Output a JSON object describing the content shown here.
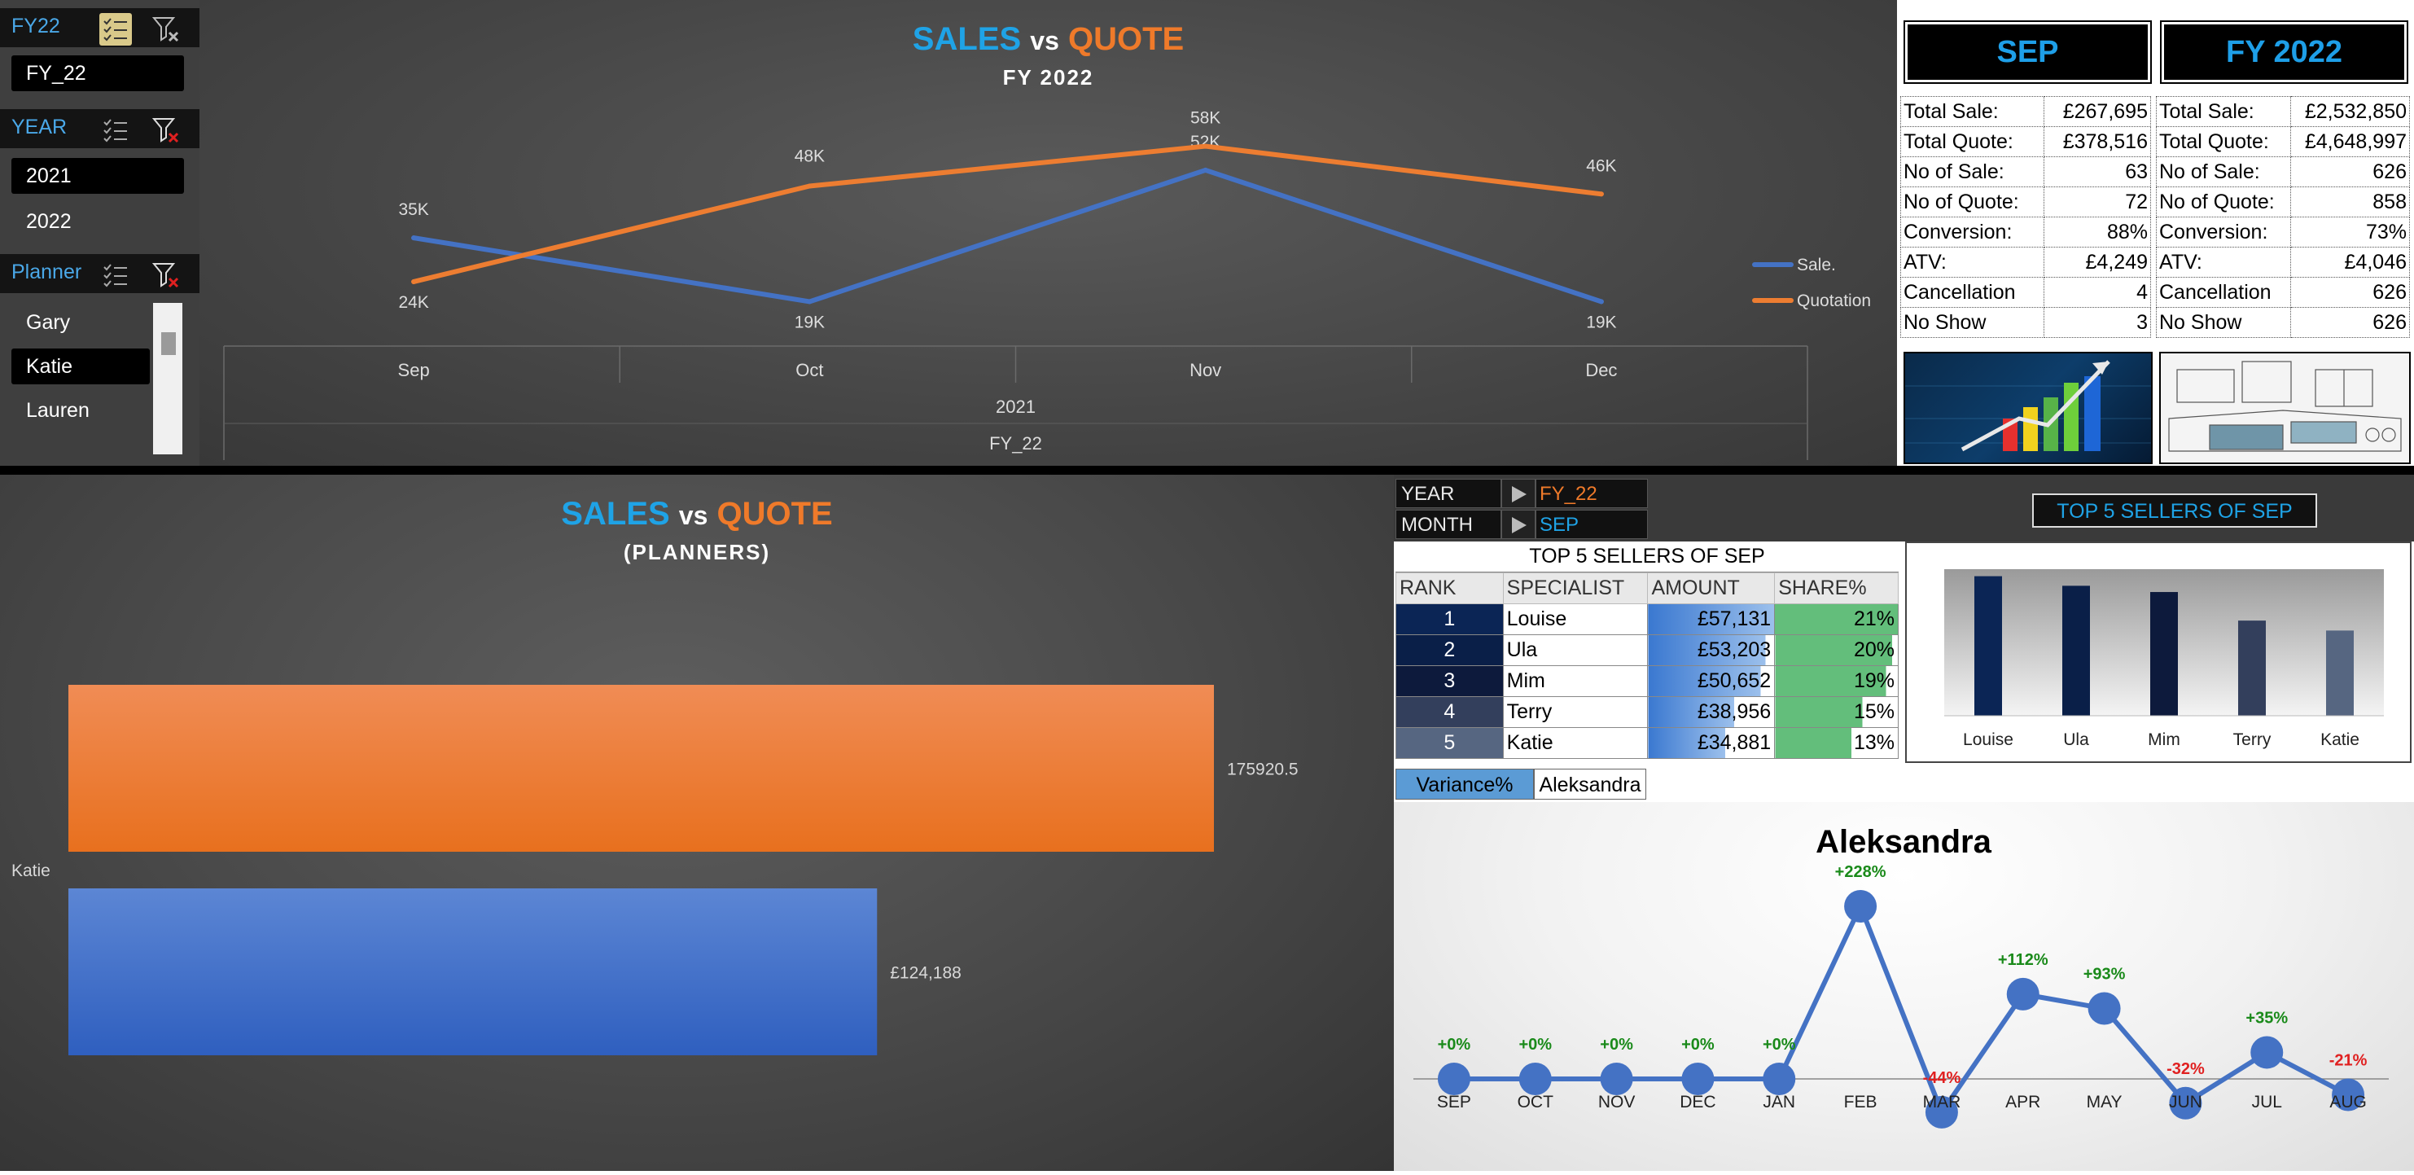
{
  "slicers": [
    {
      "title": "FY22",
      "items": [
        {
          "label": "FY_22",
          "selected": true
        }
      ]
    },
    {
      "title": "YEAR",
      "items": [
        {
          "label": "2021",
          "selected": true
        },
        {
          "label": "2022",
          "selected": false
        }
      ]
    },
    {
      "title": "Planner",
      "items": [
        {
          "label": "Gary",
          "selected": false
        },
        {
          "label": "Katie",
          "selected": true
        },
        {
          "label": "Lauren",
          "selected": false
        }
      ]
    }
  ],
  "top_chart": {
    "title_sales": "SALES",
    "title_vs": "vs",
    "title_quote": "QUOTE",
    "subtitle": "FY 2022",
    "x_group_year": "2021",
    "x_group_fy": "FY_22",
    "legend": [
      "Sale.",
      "Quotation"
    ]
  },
  "bottom_chart": {
    "title_sales": "SALES",
    "title_vs": "vs",
    "title_quote": "QUOTE",
    "subtitle": "(PLANNERS)"
  },
  "kpi_month": {
    "header": "SEP",
    "rows": [
      {
        "label": "Total Sale:",
        "value": "£267,695"
      },
      {
        "label": "Total Quote:",
        "value": "£378,516"
      },
      {
        "label": "No of Sale:",
        "value": "63"
      },
      {
        "label": "No of Quote:",
        "value": "72"
      },
      {
        "label": "Conversion:",
        "value": "88%"
      },
      {
        "label": "ATV:",
        "value": "£4,249"
      },
      {
        "label": "Cancellation",
        "value": "4"
      },
      {
        "label": "No Show",
        "value": "3"
      }
    ]
  },
  "kpi_year": {
    "header": "FY 2022",
    "rows": [
      {
        "label": "Total Sale:",
        "value": "£2,532,850"
      },
      {
        "label": "Total Quote:",
        "value": "£4,648,997"
      },
      {
        "label": "No of Sale:",
        "value": "626"
      },
      {
        "label": "No of Quote:",
        "value": "858"
      },
      {
        "label": "Conversion:",
        "value": "73%"
      },
      {
        "label": "ATV:",
        "value": "£4,046"
      },
      {
        "label": "Cancellation",
        "value": "626"
      },
      {
        "label": "No Show",
        "value": "626"
      }
    ]
  },
  "filters": {
    "year_label": "YEAR",
    "year_value": "FY_22",
    "month_label": "MONTH",
    "month_value": "SEP"
  },
  "top5": {
    "title": "TOP 5 SELLERS OF SEP",
    "badge": "TOP 5 SELLERS OF SEP",
    "headers": [
      "RANK",
      "SPECIALIST",
      "AMOUNT",
      "SHARE%"
    ],
    "rows": [
      {
        "rank": "1",
        "name": "Louise",
        "amount": "£57,131",
        "share": "21%"
      },
      {
        "rank": "2",
        "name": "Ula",
        "amount": "£53,203",
        "share": "20%"
      },
      {
        "rank": "3",
        "name": "Mim",
        "amount": "£50,652",
        "share": "19%"
      },
      {
        "rank": "4",
        "name": "Terry",
        "amount": "£38,956",
        "share": "15%"
      },
      {
        "rank": "5",
        "name": "Katie",
        "amount": "£34,881",
        "share": "13%"
      }
    ],
    "variance_label": "Variance%",
    "variance_person": "Aleksandra"
  },
  "chart_data": [
    {
      "type": "line",
      "title": "SALES vs QUOTE",
      "subtitle": "FY 2022",
      "categories": [
        "Sep",
        "Oct",
        "Nov",
        "Dec"
      ],
      "series": [
        {
          "name": "Sale.",
          "values": [
            35000,
            19000,
            52000,
            19000
          ],
          "labels": [
            "35K",
            "19K",
            "52K",
            "19K"
          ],
          "color": "#4472c4"
        },
        {
          "name": "Quotation",
          "values": [
            24000,
            48000,
            58000,
            46000
          ],
          "labels": [
            "24K",
            "48K",
            "58K",
            "46K"
          ],
          "color": "#ed7d31"
        }
      ],
      "legend": "right"
    },
    {
      "type": "bar",
      "orientation": "horizontal",
      "title": "SALES vs QUOTE",
      "subtitle": "(PLANNERS)",
      "categories": [
        "Katie"
      ],
      "series": [
        {
          "values": [
            175920.5
          ],
          "labels": [
            "175920.5"
          ],
          "color": "#ef7a2a"
        },
        {
          "values": [
            124188
          ],
          "labels": [
            "£124,188"
          ],
          "color": "#4472c4"
        }
      ]
    },
    {
      "type": "bar",
      "title": "TOP 5 SELLERS OF SEP",
      "categories": [
        "Louise",
        "Ula",
        "Mim",
        "Terry",
        "Katie"
      ],
      "values": [
        57131,
        53203,
        50652,
        38956,
        34881
      ],
      "colors": [
        "#0b2555",
        "#0a1f48",
        "#0d1a3c",
        "#333f5c",
        "#566681"
      ]
    },
    {
      "type": "line",
      "title": "Aleksandra",
      "categories": [
        "SEP",
        "OCT",
        "NOV",
        "DEC",
        "JAN",
        "FEB",
        "MAR",
        "APR",
        "MAY",
        "JUN",
        "JUL",
        "AUG"
      ],
      "values": [
        0,
        0,
        0,
        0,
        0,
        228,
        -44,
        112,
        93,
        -32,
        35,
        -21
      ],
      "labels": [
        "+0%",
        "+0%",
        "+0%",
        "+0%",
        "+0%",
        "+228%",
        "-44%",
        "+112%",
        "+93%",
        "-32%",
        "+35%",
        "-21%"
      ],
      "color": "#4472c4"
    }
  ]
}
